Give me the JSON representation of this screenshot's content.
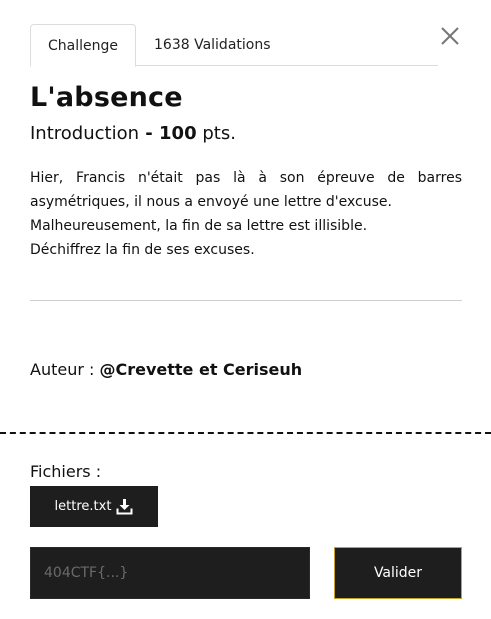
{
  "tabs": [
    {
      "label": "Challenge",
      "active": true
    },
    {
      "label": "1638 Validations",
      "active": false
    }
  ],
  "close_icon": "close-icon",
  "challenge": {
    "title": "L'absence",
    "category": "Introduction",
    "separator": " - ",
    "points": "100",
    "points_unit": " pts.",
    "description": [
      "Hier, Francis n'était pas là à son épreuve de barres asymétriques, il nous a envoyé une lettre d'excuse.",
      "Malheureusement, la fin de sa lettre est illisible.",
      "Déchiffrez la fin de ses excuses."
    ],
    "author_label": "Auteur : ",
    "author_name": "@Crevette et Ceriseuh"
  },
  "files": {
    "label": "Fichiers :",
    "items": [
      {
        "name": "lettre.txt",
        "icon": "download-icon"
      }
    ]
  },
  "flag": {
    "placeholder": "404CTF{...}",
    "value": "",
    "submit_label": "Valider"
  },
  "colors": {
    "dark_button": "#1e1e1e",
    "accent_border": "#c9a227"
  }
}
